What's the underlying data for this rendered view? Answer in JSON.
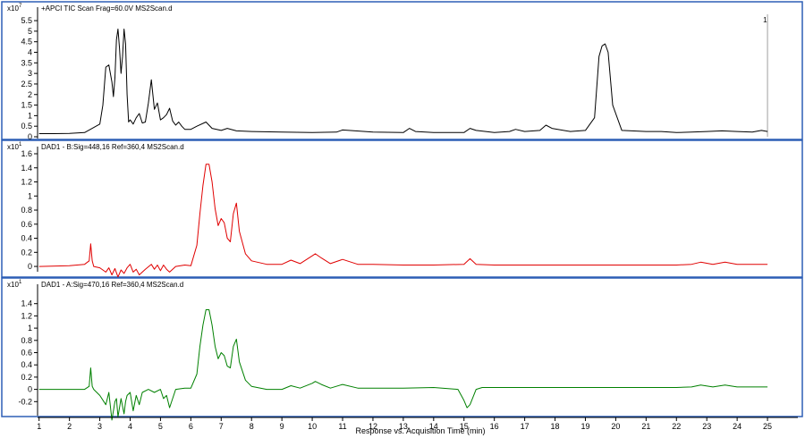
{
  "chart_data": [
    {
      "type": "line",
      "title": "+APCI TIC Scan Frag=60.0V MS2Scan.d",
      "y_scale_multiplier": "x10",
      "y_scale_exponent": "7",
      "ylim": [
        0,
        5.8
      ],
      "yticks": [
        "0",
        "0.5",
        "1",
        "1.5",
        "2",
        "2.5",
        "3",
        "3.5",
        "4",
        "4.5",
        "5",
        "5.5"
      ],
      "ytick_values": [
        0,
        0.5,
        1,
        1.5,
        2,
        2.5,
        3,
        3.5,
        4,
        4.5,
        5,
        5.5
      ],
      "marker_label": "1",
      "marker_x": 25,
      "color": "#000000",
      "series": [
        {
          "x": [
            1,
            1.5,
            2,
            2.5,
            3,
            3.1,
            3.2,
            3.3,
            3.4,
            3.45,
            3.5,
            3.55,
            3.6,
            3.65,
            3.7,
            3.75,
            3.8,
            3.85,
            3.9,
            3.95,
            4.0,
            4.1,
            4.2,
            4.3,
            4.4,
            4.5,
            4.6,
            4.7,
            4.8,
            4.9,
            5.0,
            5.1,
            5.2,
            5.3,
            5.4,
            5.5,
            5.6,
            5.7,
            5.8,
            6.0,
            6.2,
            6.5,
            6.7,
            7.0,
            7.2,
            7.5,
            8,
            9,
            10,
            10.8,
            11,
            12,
            13,
            13.2,
            13.4,
            14,
            15,
            15.2,
            15.4,
            16,
            16.5,
            16.7,
            17,
            17.5,
            17.7,
            17.9,
            18.5,
            19.0,
            19.3,
            19.45,
            19.55,
            19.65,
            19.75,
            19.9,
            20.2,
            21,
            21.5,
            22,
            22.5,
            23,
            23.5,
            24,
            24.5,
            24.8,
            25
          ],
          "y": [
            0.15,
            0.15,
            0.16,
            0.2,
            0.6,
            1.5,
            3.3,
            3.4,
            2.6,
            1.9,
            2.8,
            4.6,
            5.1,
            4.2,
            3.0,
            3.8,
            5.1,
            4.4,
            2.0,
            0.7,
            0.8,
            0.6,
            0.9,
            1.1,
            0.65,
            0.7,
            1.6,
            2.7,
            1.3,
            1.6,
            0.8,
            0.9,
            1.05,
            1.35,
            0.75,
            0.55,
            0.7,
            0.5,
            0.35,
            0.35,
            0.5,
            0.7,
            0.4,
            0.3,
            0.4,
            0.28,
            0.25,
            0.22,
            0.2,
            0.22,
            0.32,
            0.22,
            0.2,
            0.4,
            0.25,
            0.2,
            0.2,
            0.4,
            0.3,
            0.2,
            0.25,
            0.35,
            0.25,
            0.3,
            0.55,
            0.4,
            0.25,
            0.3,
            0.9,
            3.8,
            4.3,
            4.4,
            4.0,
            1.5,
            0.3,
            0.25,
            0.25,
            0.2,
            0.22,
            0.25,
            0.28,
            0.25,
            0.22,
            0.3,
            0.25
          ]
        }
      ]
    },
    {
      "type": "line",
      "title": "DAD1 - B:Sig=448,16 Ref=360,4 MS2Scan.d",
      "y_scale_multiplier": "x10",
      "y_scale_exponent": "1",
      "ylim": [
        -0.05,
        1.6
      ],
      "yticks": [
        "0",
        "0.2",
        "0.4",
        "0.6",
        "0.8",
        "1",
        "1.2",
        "1.4",
        "1.6"
      ],
      "ytick_values": [
        0,
        0.2,
        0.4,
        0.6,
        0.8,
        1,
        1.2,
        1.4,
        1.6
      ],
      "color": "#e00000",
      "series": [
        {
          "x": [
            1,
            2,
            2.5,
            2.65,
            2.7,
            2.75,
            2.8,
            3.0,
            3.2,
            3.3,
            3.4,
            3.5,
            3.6,
            3.7,
            3.8,
            3.9,
            4.0,
            4.1,
            4.2,
            4.3,
            4.5,
            4.7,
            4.8,
            4.9,
            5.0,
            5.1,
            5.2,
            5.3,
            5.5,
            5.8,
            6.0,
            6.2,
            6.3,
            6.4,
            6.5,
            6.6,
            6.7,
            6.8,
            6.9,
            7.0,
            7.1,
            7.2,
            7.3,
            7.4,
            7.5,
            7.6,
            7.8,
            8.0,
            8.5,
            9.0,
            9.3,
            9.6,
            10.0,
            10.1,
            10.3,
            10.6,
            11.0,
            11.5,
            12.0,
            13,
            14,
            15.0,
            15.2,
            15.4,
            16,
            17,
            18,
            19,
            20,
            21,
            22,
            22.5,
            22.8,
            23.2,
            23.6,
            24,
            25
          ],
          "y": [
            0.0,
            0.01,
            0.03,
            0.08,
            0.32,
            0.08,
            0.0,
            -0.02,
            -0.08,
            -0.02,
            -0.12,
            -0.03,
            -0.15,
            -0.05,
            -0.1,
            -0.02,
            0.03,
            -0.08,
            -0.04,
            -0.12,
            -0.04,
            0.03,
            -0.04,
            0.02,
            -0.06,
            0.02,
            -0.04,
            -0.08,
            0.0,
            0.02,
            0.01,
            0.3,
            0.75,
            1.15,
            1.45,
            1.45,
            1.2,
            0.82,
            0.58,
            0.68,
            0.62,
            0.4,
            0.35,
            0.75,
            0.9,
            0.5,
            0.18,
            0.08,
            0.03,
            0.03,
            0.09,
            0.04,
            0.15,
            0.18,
            0.12,
            0.04,
            0.1,
            0.03,
            0.03,
            0.02,
            0.02,
            0.03,
            0.11,
            0.03,
            0.02,
            0.02,
            0.02,
            0.02,
            0.02,
            0.02,
            0.02,
            0.03,
            0.06,
            0.03,
            0.06,
            0.03,
            0.03
          ]
        }
      ]
    },
    {
      "type": "line",
      "title": "DAD1 - A:Sig=470,16 Ref=360,4 MS2Scan.d",
      "y_scale_multiplier": "x10",
      "y_scale_exponent": "1",
      "ylim": [
        -0.4,
        1.6
      ],
      "yticks": [
        "-0.2",
        "0",
        "0.2",
        "0.4",
        "0.6",
        "0.8",
        "1",
        "1.2",
        "1.4"
      ],
      "ytick_values": [
        -0.2,
        0,
        0.2,
        0.4,
        0.6,
        0.8,
        1,
        1.2,
        1.4
      ],
      "xlabel": "Response vs. Acquisition Time (min)",
      "xticks": [
        "1",
        "2",
        "3",
        "4",
        "5",
        "6",
        "7",
        "8",
        "9",
        "10",
        "11",
        "12",
        "13",
        "14",
        "15",
        "16",
        "17",
        "18",
        "19",
        "20",
        "21",
        "22",
        "23",
        "24",
        "25"
      ],
      "xtick_values": [
        1,
        2,
        3,
        4,
        5,
        6,
        7,
        8,
        9,
        10,
        11,
        12,
        13,
        14,
        15,
        16,
        17,
        18,
        19,
        20,
        21,
        22,
        23,
        24,
        25
      ],
      "xlim": [
        0.95,
        26.0
      ],
      "color": "#008000",
      "series": [
        {
          "x": [
            1,
            2,
            2.5,
            2.65,
            2.7,
            2.75,
            2.8,
            3.0,
            3.2,
            3.3,
            3.4,
            3.5,
            3.55,
            3.6,
            3.7,
            3.8,
            3.85,
            3.9,
            4.0,
            4.1,
            4.2,
            4.3,
            4.4,
            4.6,
            4.8,
            5.0,
            5.1,
            5.2,
            5.3,
            5.5,
            5.8,
            6.0,
            6.2,
            6.3,
            6.4,
            6.5,
            6.6,
            6.7,
            6.8,
            6.9,
            7.0,
            7.1,
            7.2,
            7.3,
            7.4,
            7.5,
            7.6,
            7.8,
            8.0,
            8.5,
            9.0,
            9.3,
            9.6,
            10.0,
            10.1,
            10.3,
            10.6,
            11.0,
            11.5,
            12.0,
            13,
            14,
            14.8,
            15.0,
            15.1,
            15.2,
            15.4,
            15.6,
            16,
            17,
            18,
            19,
            20,
            21,
            22,
            22.5,
            22.8,
            23.2,
            23.6,
            24,
            25
          ],
          "y": [
            0.0,
            0.0,
            0.0,
            0.05,
            0.35,
            0.05,
            0.0,
            -0.1,
            -0.25,
            -0.05,
            -0.5,
            -0.2,
            -0.15,
            -0.45,
            -0.15,
            -0.4,
            -0.2,
            -0.1,
            -0.05,
            -0.35,
            -0.1,
            -0.25,
            -0.05,
            0.0,
            -0.05,
            0.0,
            -0.15,
            -0.1,
            -0.3,
            0.0,
            0.02,
            0.02,
            0.25,
            0.7,
            1.05,
            1.3,
            1.3,
            1.05,
            0.7,
            0.5,
            0.6,
            0.55,
            0.38,
            0.35,
            0.7,
            0.82,
            0.45,
            0.15,
            0.05,
            0.0,
            0.0,
            0.06,
            0.02,
            0.1,
            0.13,
            0.08,
            0.02,
            0.08,
            0.02,
            0.02,
            0.02,
            0.03,
            0.0,
            -0.18,
            -0.3,
            -0.25,
            0.0,
            0.03,
            0.03,
            0.03,
            0.03,
            0.03,
            0.03,
            0.03,
            0.03,
            0.04,
            0.07,
            0.04,
            0.07,
            0.04,
            0.04
          ]
        }
      ]
    }
  ]
}
